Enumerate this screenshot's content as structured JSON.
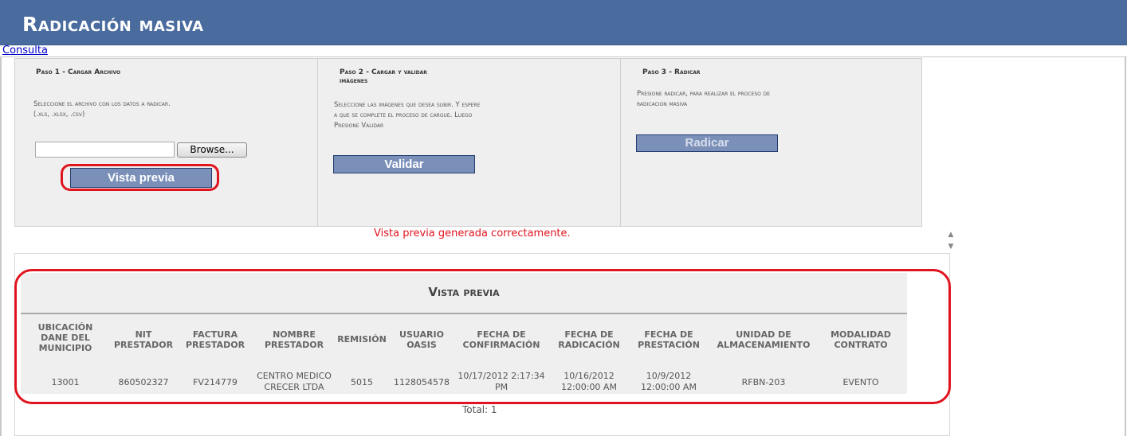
{
  "header": {
    "title": "Radicación masiva"
  },
  "nav": {
    "consulta_label": "Consulta"
  },
  "steps": [
    {
      "title": "Paso 1 - Cargar Archivo",
      "desc_line1": "Seleccione el archivo con los datos a radicar.",
      "desc_line2": "(.xls, .xlsx, .csv)",
      "browse_label": "Browse...",
      "button_label": "Vista previa"
    },
    {
      "title_line1": "Paso 2 - Cargar y validar",
      "title_line2": "imágenes",
      "desc_line1": "Seleccione las imágenes que desea subir. Y espere",
      "desc_line2": "a que se complete el proceso de cargue. Luego",
      "desc_line3": "Presione Validar",
      "button_label": "Validar"
    },
    {
      "title": "Paso 3 - Radicar",
      "desc_line1": "Presione radicar, para realizar el proceso de",
      "desc_line2": "radicacion masiva",
      "button_label": "Radicar"
    }
  ],
  "status": {
    "message": "Vista previa generada correctamente."
  },
  "preview": {
    "title": "Vista previa",
    "columns": [
      [
        "UBICACIÓN",
        "DANE DEL",
        "MUNICIPIO"
      ],
      [
        "NIT",
        "PRESTADOR"
      ],
      [
        "FACTURA",
        "PRESTADOR"
      ],
      [
        "NOMBRE",
        "PRESTADOR"
      ],
      [
        "REMISIÓN"
      ],
      [
        "USUARIO",
        "OASIS"
      ],
      [
        "FECHA DE",
        "CONFIRMACIÓN"
      ],
      [
        "FECHA DE",
        "RADICACIÓN"
      ],
      [
        "FECHA DE",
        "PRESTACIÓN"
      ],
      [
        "UNIDAD DE",
        "ALMACENAMIENTO"
      ],
      [
        "MODALIDAD",
        "CONTRATO"
      ]
    ],
    "rows": [
      [
        [
          "13001"
        ],
        [
          "860502327"
        ],
        [
          "FV214779"
        ],
        [
          "CENTRO MEDICO",
          "CRECER LTDA"
        ],
        [
          "5015"
        ],
        [
          "1128054578"
        ],
        [
          "10/17/2012 2:17:34",
          "PM"
        ],
        [
          "10/16/2012",
          "12:00:00 AM"
        ],
        [
          "10/9/2012",
          "12:00:00 AM"
        ],
        [
          "RFBN-203"
        ],
        [
          "EVENTO"
        ]
      ]
    ],
    "total_label": "Total: 1"
  },
  "icons": {
    "scroll_up": "scroll-up-arrow-icon",
    "scroll_down": "scroll-down-arrow-icon"
  },
  "colors": {
    "header_bg": "#4a6b9d",
    "button_bg": "#7b90b9",
    "highlight": "#e0141e"
  }
}
